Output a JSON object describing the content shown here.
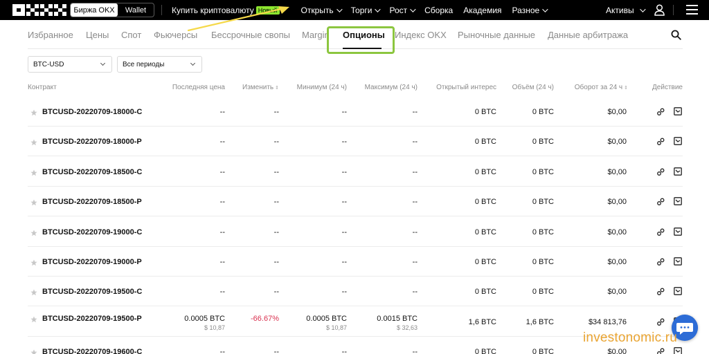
{
  "topnav": {
    "exchange_toggle": {
      "active": "Биржа OKX",
      "inactive": "Wallet"
    },
    "items": [
      {
        "label": "Купить криптовалюту",
        "badge": "Новый",
        "has_chevron": false
      },
      {
        "label": "Открыть",
        "has_chevron": true
      },
      {
        "label": "Торги",
        "has_chevron": true
      },
      {
        "label": "Рост",
        "has_chevron": true
      },
      {
        "label": "Сборка",
        "has_chevron": false
      },
      {
        "label": "Академия",
        "has_chevron": false
      },
      {
        "label": "Разное",
        "has_chevron": true
      }
    ],
    "assets_label": "Активы"
  },
  "subnav": {
    "tabs": [
      {
        "label": "Избранное"
      },
      {
        "label": "Цены"
      },
      {
        "label": "Спот"
      },
      {
        "label": "Фьючерсы"
      },
      {
        "label": "Бессрочные свопы"
      },
      {
        "label": "Margin"
      },
      {
        "label": "Опционы",
        "active": true
      },
      {
        "label": "Индекс OKX"
      },
      {
        "label": "Рыночные данные"
      },
      {
        "label": "Данные арбитража"
      }
    ]
  },
  "filters": {
    "pair": "BTC-USD",
    "period": "Все периоды"
  },
  "table": {
    "headers": {
      "contract": "Контракт",
      "last_price": "Последняя цена",
      "change": "Изменить",
      "low": "Минимум (24 ч)",
      "high": "Максимум (24 ч)",
      "open_interest": "Открытый интерес",
      "volume": "Объём (24 ч)",
      "turnover": "Оборот за 24 ч",
      "action": "Действие"
    },
    "rows": [
      {
        "contract": "BTCUSD-20220709-18000-C",
        "last": "--",
        "last_sub": "",
        "change": "--",
        "low": "--",
        "low_sub": "",
        "high": "--",
        "high_sub": "",
        "oi": "0 BTC",
        "vol": "0 BTC",
        "turnover": "$0,00"
      },
      {
        "contract": "BTCUSD-20220709-18000-P",
        "last": "--",
        "last_sub": "",
        "change": "--",
        "low": "--",
        "low_sub": "",
        "high": "--",
        "high_sub": "",
        "oi": "0 BTC",
        "vol": "0 BTC",
        "turnover": "$0,00"
      },
      {
        "contract": "BTCUSD-20220709-18500-C",
        "last": "--",
        "last_sub": "",
        "change": "--",
        "low": "--",
        "low_sub": "",
        "high": "--",
        "high_sub": "",
        "oi": "0 BTC",
        "vol": "0 BTC",
        "turnover": "$0,00"
      },
      {
        "contract": "BTCUSD-20220709-18500-P",
        "last": "--",
        "last_sub": "",
        "change": "--",
        "low": "--",
        "low_sub": "",
        "high": "--",
        "high_sub": "",
        "oi": "0 BTC",
        "vol": "0 BTC",
        "turnover": "$0,00"
      },
      {
        "contract": "BTCUSD-20220709-19000-C",
        "last": "--",
        "last_sub": "",
        "change": "--",
        "low": "--",
        "low_sub": "",
        "high": "--",
        "high_sub": "",
        "oi": "0 BTC",
        "vol": "0 BTC",
        "turnover": "$0,00"
      },
      {
        "contract": "BTCUSD-20220709-19000-P",
        "last": "--",
        "last_sub": "",
        "change": "--",
        "low": "--",
        "low_sub": "",
        "high": "--",
        "high_sub": "",
        "oi": "0 BTC",
        "vol": "0 BTC",
        "turnover": "$0,00"
      },
      {
        "contract": "BTCUSD-20220709-19500-C",
        "last": "--",
        "last_sub": "",
        "change": "--",
        "low": "--",
        "low_sub": "",
        "high": "--",
        "high_sub": "",
        "oi": "0 BTC",
        "vol": "0 BTC",
        "turnover": "$0,00"
      },
      {
        "contract": "BTCUSD-20220709-19500-P",
        "last": "0.0005 BTC",
        "last_sub": "$ 10,87",
        "change": "-66.67%",
        "change_negative": true,
        "low": "0.0005 BTC",
        "low_sub": "$ 10,87",
        "high": "0.0015 BTC",
        "high_sub": "$ 32,63",
        "oi": "1,6 BTC",
        "vol": "1,6 BTC",
        "turnover": "$34 813,76"
      },
      {
        "contract": "BTCUSD-20220709-19600-C",
        "last": "--",
        "last_sub": "",
        "change": "--",
        "low": "--",
        "low_sub": "",
        "high": "--",
        "high_sub": "",
        "oi": "0 BTC",
        "vol": "0 BTC",
        "turnover": "$0,00"
      }
    ]
  },
  "watermark": "investonomic.ru",
  "colors": {
    "nav_bg": "#000000",
    "new_badge": "#8ee62f",
    "highlight_box": "#8cc63f",
    "annotation_arrow": "#f5d94a",
    "negative": "#d9304f",
    "chat_bubble": "#2d6cd6",
    "watermark": "#e9a432"
  },
  "icons": {
    "logo": "okx-logo",
    "user": "user-icon",
    "menu": "hamburger-menu-icon",
    "search": "search-icon",
    "favorite": "star-icon",
    "action_trade": "trade-icon",
    "action_chart": "chart-open-icon",
    "chat": "chat-bubble-icon"
  }
}
